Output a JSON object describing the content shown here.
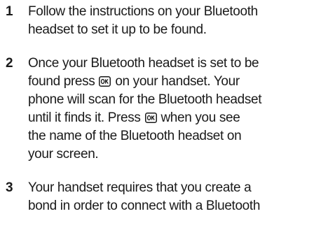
{
  "steps": [
    {
      "number": "1",
      "lines": [
        "Follow the instructions on your Bluetooth",
        "headset to set it up to be found."
      ]
    },
    {
      "number": "2",
      "line1": "Once your Bluetooth headset is set to be",
      "line2_before": "found press",
      "line2_after": "on your handset. Your",
      "line3": "phone will scan for the Bluetooth headset",
      "line4_before": "until it finds it. Press",
      "line4_after": "when you see",
      "line5": "the name of the Bluetooth headset on",
      "line6": "your screen."
    },
    {
      "number": "3",
      "lines": [
        "Your handset requires that you create a",
        "bond in order to connect with a Bluetooth"
      ]
    }
  ],
  "icons": {
    "ok_key": "ok-key-icon"
  }
}
